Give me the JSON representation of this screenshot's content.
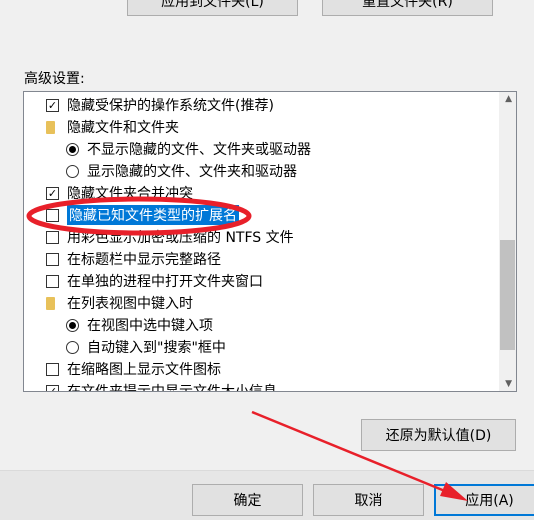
{
  "top_buttons": {
    "apply_to_folders": "应用到文件夹(L)",
    "reset_folders": "重置文件夹(R)"
  },
  "advanced_label": "高级设置:",
  "items": [
    {
      "kind": "checkbox",
      "checked": true,
      "text": "隐藏受保护的操作系统文件(推荐)"
    },
    {
      "kind": "folder",
      "text": "隐藏文件和文件夹"
    },
    {
      "kind": "radio",
      "checked": true,
      "text": "不显示隐藏的文件、文件夹或驱动器"
    },
    {
      "kind": "radio",
      "checked": false,
      "text": "显示隐藏的文件、文件夹和驱动器"
    },
    {
      "kind": "checkbox",
      "checked": true,
      "text": "隐藏文件夹合并冲突"
    },
    {
      "kind": "checkbox",
      "checked": false,
      "text": "隐藏已知文件类型的扩展名",
      "selected": true
    },
    {
      "kind": "checkbox",
      "checked": false,
      "text": "用彩色显示加密或压缩的 NTFS 文件"
    },
    {
      "kind": "checkbox",
      "checked": false,
      "text": "在标题栏中显示完整路径"
    },
    {
      "kind": "checkbox",
      "checked": false,
      "text": "在单独的进程中打开文件夹窗口"
    },
    {
      "kind": "folder",
      "text": "在列表视图中键入时"
    },
    {
      "kind": "radio",
      "checked": true,
      "text": "在视图中选中键入项"
    },
    {
      "kind": "radio",
      "checked": false,
      "text": "自动键入到\"搜索\"框中"
    },
    {
      "kind": "checkbox",
      "checked": false,
      "text": "在缩略图上显示文件图标"
    },
    {
      "kind": "checkbox",
      "checked": true,
      "text": "在文件夹提示中显示文件大小信息"
    }
  ],
  "restore_defaults": "还原为默认值(D)",
  "footer": {
    "ok": "确定",
    "cancel": "取消",
    "apply": "应用(A)"
  },
  "annotation_color": "#e8202a"
}
